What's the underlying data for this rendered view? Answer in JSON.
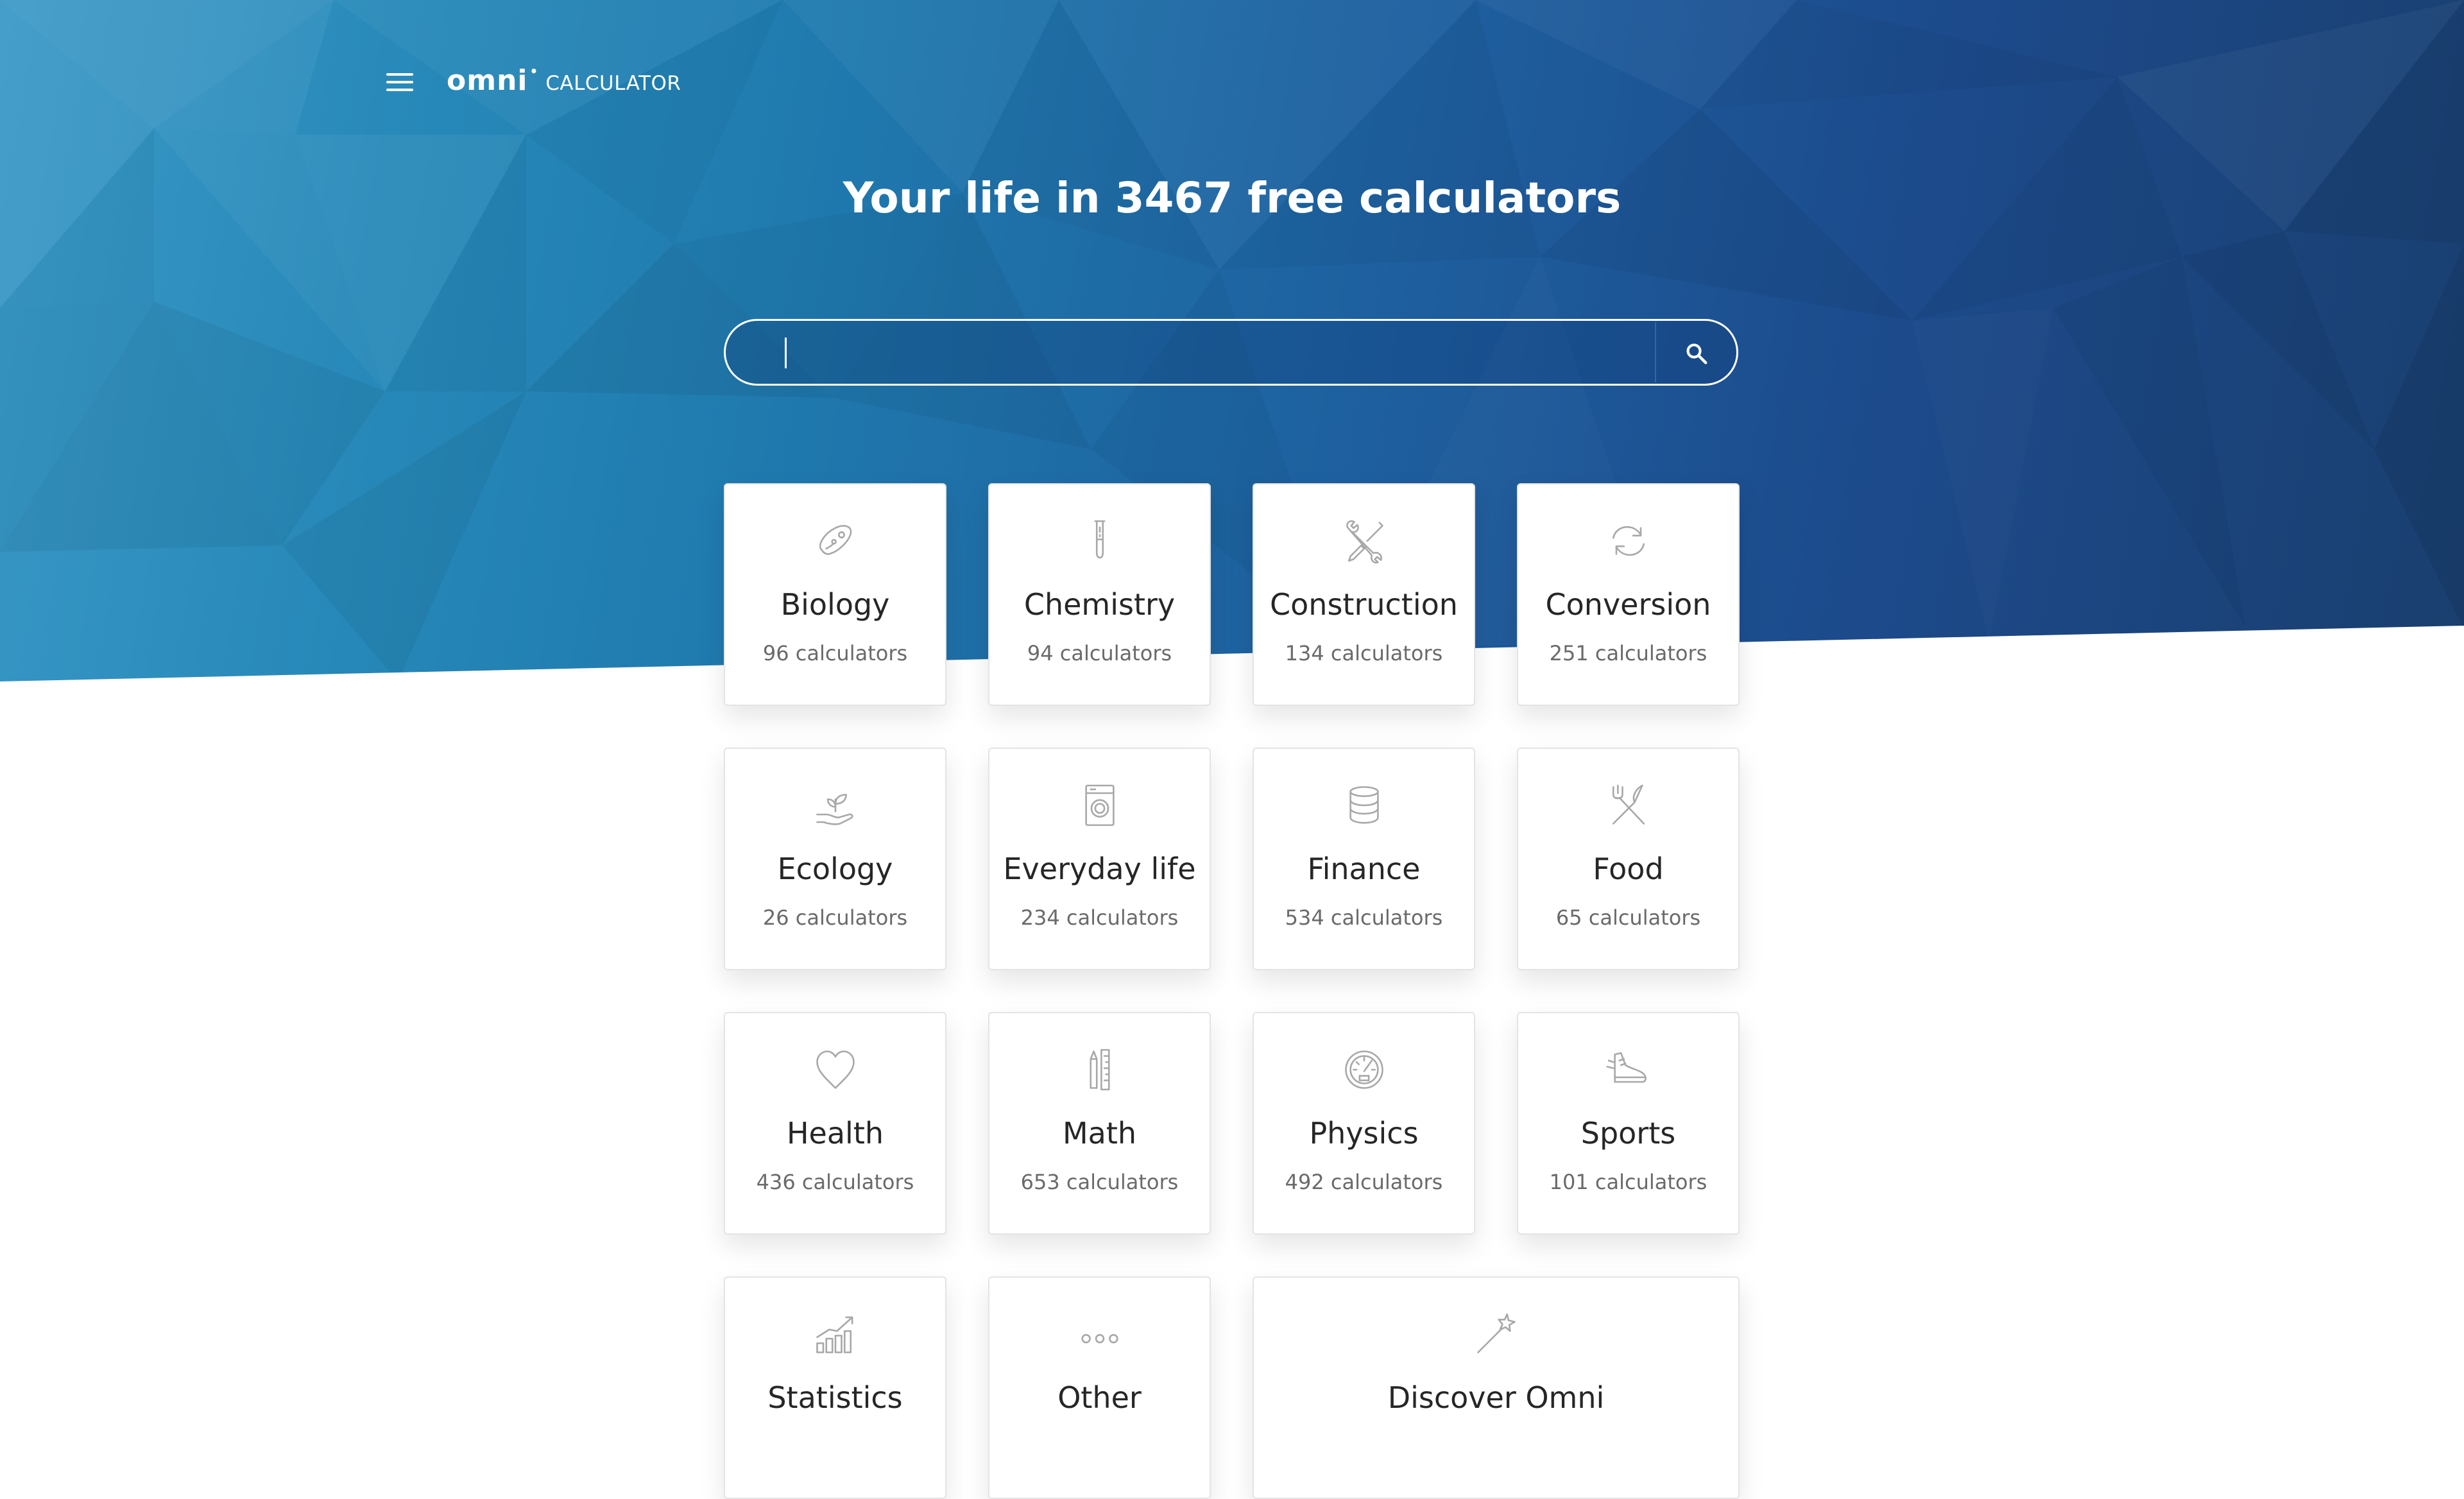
{
  "header": {
    "logo_main": "omni",
    "logo_sub": "CALCULATOR"
  },
  "hero": {
    "title": "Your life in 3467 free calculators"
  },
  "search": {
    "value": "",
    "placeholder": ""
  },
  "categories": [
    {
      "name": "Biology",
      "count": "96 calculators",
      "icon": "petri-dish-icon"
    },
    {
      "name": "Chemistry",
      "count": "94 calculators",
      "icon": "test-tube-icon"
    },
    {
      "name": "Construction",
      "count": "134 calculators",
      "icon": "wrench-screwdriver-icon"
    },
    {
      "name": "Conversion",
      "count": "251 calculators",
      "icon": "refresh-arrows-icon"
    },
    {
      "name": "Ecology",
      "count": "26 calculators",
      "icon": "hand-sprout-icon"
    },
    {
      "name": "Everyday life",
      "count": "234 calculators",
      "icon": "washing-machine-icon"
    },
    {
      "name": "Finance",
      "count": "534 calculators",
      "icon": "coin-stack-icon"
    },
    {
      "name": "Food",
      "count": "65 calculators",
      "icon": "fork-knife-icon"
    },
    {
      "name": "Health",
      "count": "436 calculators",
      "icon": "heart-icon"
    },
    {
      "name": "Math",
      "count": "653 calculators",
      "icon": "pencil-ruler-icon"
    },
    {
      "name": "Physics",
      "count": "492 calculators",
      "icon": "speedometer-icon"
    },
    {
      "name": "Sports",
      "count": "101 calculators",
      "icon": "running-shoe-icon"
    },
    {
      "name": "Statistics",
      "count": "",
      "icon": "bar-chart-trend-icon"
    },
    {
      "name": "Other",
      "count": "",
      "icon": "ellipsis-icon"
    },
    {
      "name": "Discover Omni",
      "count": "",
      "icon": "magic-wand-icon"
    }
  ],
  "colors": {
    "hero_start": "#3a98c6",
    "hero_end": "#1a3f6f",
    "card_border": "#e4e4e4",
    "icon_stroke": "#a8a8a8",
    "text_primary": "#262626",
    "text_secondary": "#6a6a6a"
  }
}
